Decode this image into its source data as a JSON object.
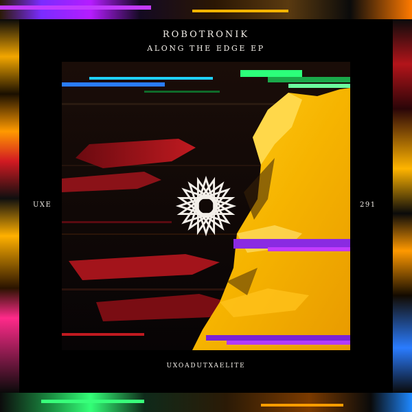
{
  "cover": {
    "artist": "ROBOTRONIK",
    "title": "ALONG THE EDGE EP",
    "label_prefix": "UXE",
    "catalog_number": "291",
    "label_name": "UXOADUTXAELITE"
  },
  "icons": {
    "emblem": "star-polygon-icon"
  },
  "colors": {
    "background": "#000000",
    "text": "#f3efe9",
    "yellow": "#f6b400",
    "red": "#b3141a",
    "purple": "#8a2be2",
    "green": "#2cff7a",
    "blue": "#2a7cff"
  }
}
